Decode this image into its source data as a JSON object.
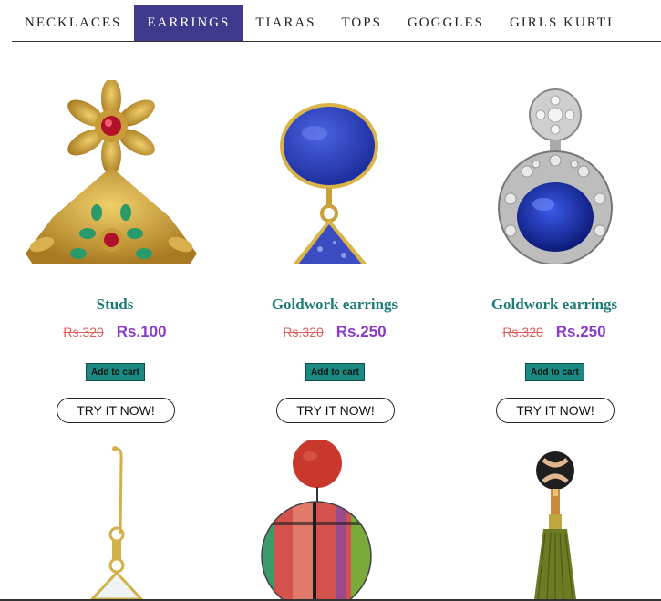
{
  "tabs": [
    {
      "label": "NECKLACES",
      "active": false
    },
    {
      "label": "EARRINGS",
      "active": true
    },
    {
      "label": "TIARAS",
      "active": false
    },
    {
      "label": "TOPS",
      "active": false
    },
    {
      "label": "GOGGLES",
      "active": false
    },
    {
      "label": "GIRLS KURTI",
      "active": false
    }
  ],
  "colors": {
    "active_tab": "#3f3a8c",
    "title": "#1e7b78",
    "old_price": "#e0605e",
    "new_price": "#8a3ac8",
    "cart_button": "#1a8a82"
  },
  "products": [
    {
      "title": "Studs",
      "old_price": "Rs.320",
      "new_price": "Rs.100",
      "cart_label": "Add to cart",
      "try_label": "TRY IT NOW!",
      "image": "gold-kundan-earring"
    },
    {
      "title": "Goldwork earrings",
      "old_price": "Rs.320",
      "new_price": "Rs.250",
      "cart_label": "Add to cart",
      "try_label": "TRY IT NOW!",
      "image": "lapis-drop-earring"
    },
    {
      "title": "Goldwork earrings",
      "old_price": "Rs.320",
      "new_price": "Rs.250",
      "cart_label": "Add to cart",
      "try_label": "TRY IT NOW!",
      "image": "sapphire-diamond-earring"
    },
    {
      "image": "crystal-hook-earring"
    },
    {
      "image": "striped-disc-earring"
    },
    {
      "image": "olive-tassel-earring"
    }
  ]
}
